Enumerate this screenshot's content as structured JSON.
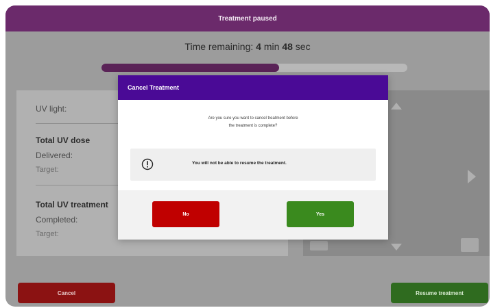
{
  "header": {
    "title": "Treatment paused"
  },
  "timer": {
    "prefix": "Time remaining: ",
    "minutes": "4",
    "min_label": " min ",
    "seconds": "48",
    "sec_label": " sec"
  },
  "progress": {
    "fraction": 0.58,
    "color": "#5a2357"
  },
  "panel": {
    "uv_light_label": "UV light:",
    "dose_title": "Total UV dose",
    "dose_delivered_label": "Delivered:",
    "dose_target_label": "Target:",
    "treatment_title": "Total UV treatment",
    "treatment_completed_label": "Completed:",
    "treatment_target_label": "Target:"
  },
  "footer": {
    "cancel_label": "Cancel",
    "resume_label": "Resume treatment"
  },
  "modal": {
    "title": "Cancel Treatment",
    "question_line1": "Are you sure you want to cancel treatment before",
    "question_line2": "the treatment is complete?",
    "warning_icon": "exclamation-circle-icon",
    "warning_text": "You will not be able to resume the treatment.",
    "no_label": "No",
    "yes_label": "Yes"
  },
  "colors": {
    "header": "#6b2a6b",
    "modal_header": "#4a0a96",
    "no_button": "#c00000",
    "yes_button": "#3a8a1e",
    "cancel_button": "#8b1212",
    "resume_button": "#2f6b1f"
  }
}
